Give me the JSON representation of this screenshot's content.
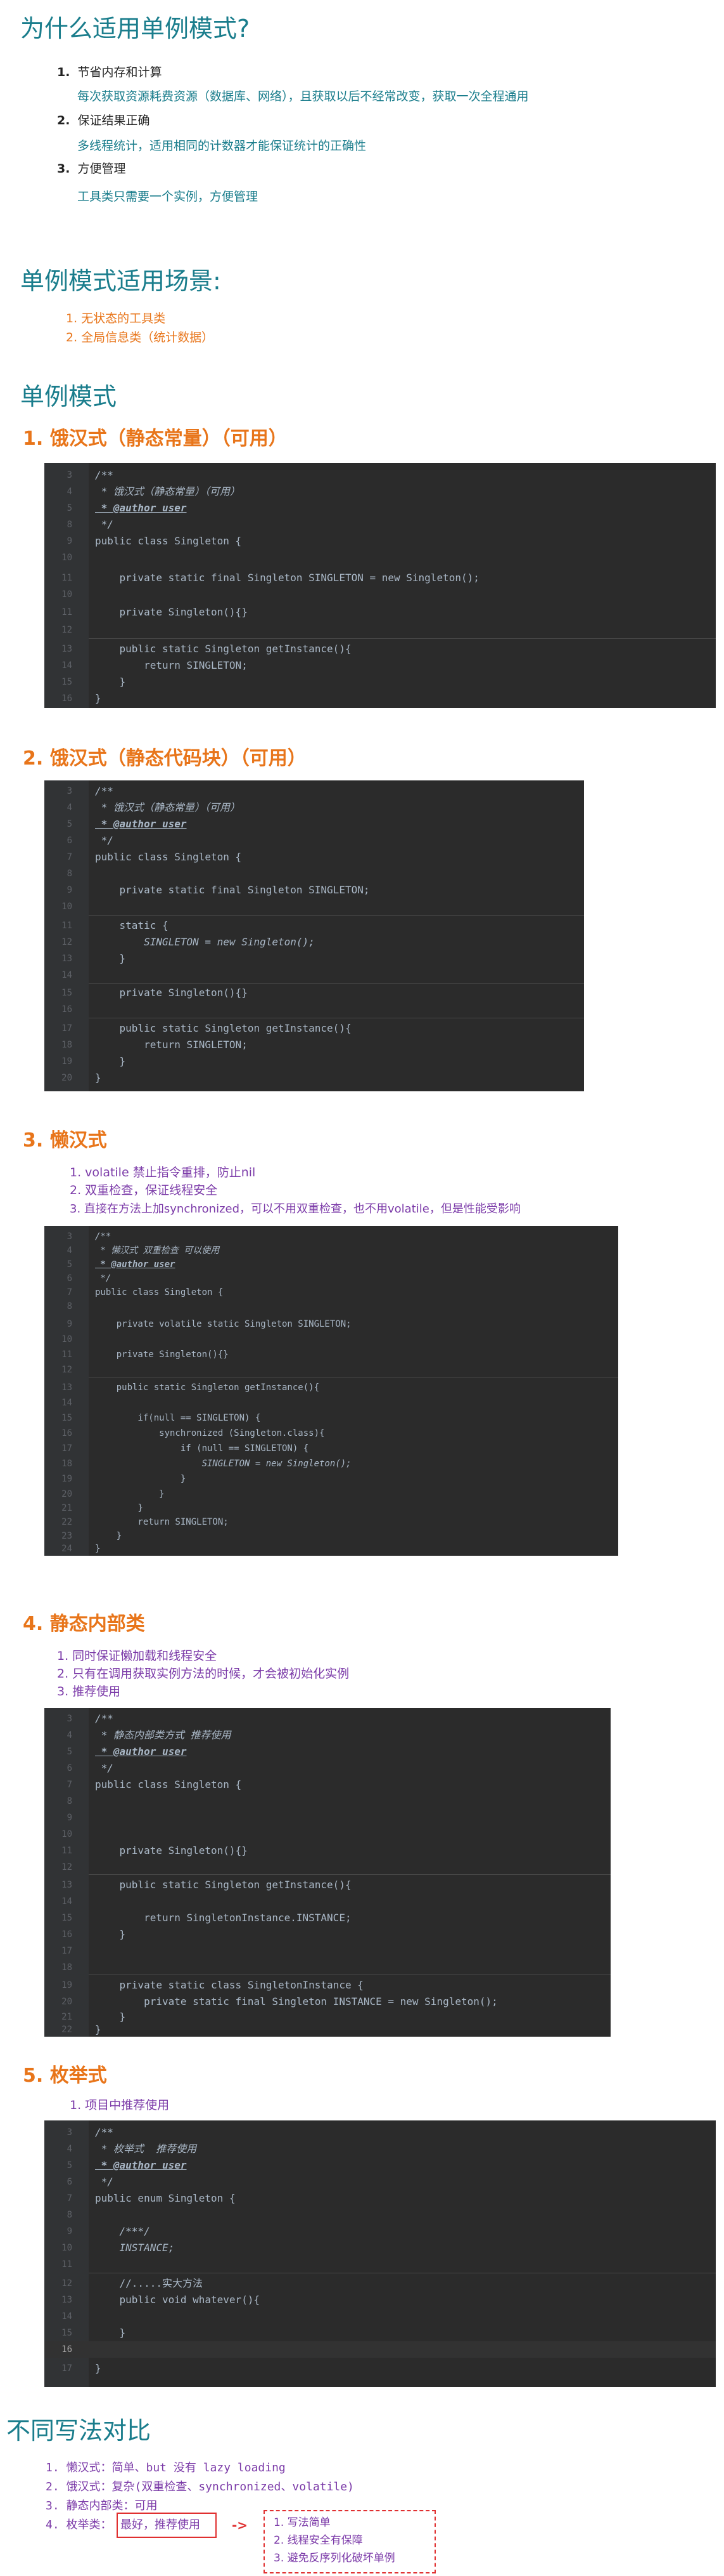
{
  "why": {
    "title": "为什么适用单例模式?",
    "items": [
      {
        "num": "1.",
        "label": "节省内存和计算",
        "desc": "每次获取资源耗费资源（数据库、网络），且获取以后不经常改变，获取一次全程通用"
      },
      {
        "num": "2.",
        "label": "保证结果正确",
        "desc": "多线程统计，适用相同的计数器才能保证统计的正确性"
      },
      {
        "num": "3.",
        "label": "方便管理",
        "desc": "工具类只需要一个实例，方便管理"
      }
    ]
  },
  "scenes": {
    "title": "单例模式适用场景:",
    "items": [
      "1.  无状态的工具类",
      "2.  全局信息类（统计数据）"
    ]
  },
  "singleton": {
    "title": "单例模式",
    "s1": {
      "title": "1. 饿汉式（静态常量）（可用）"
    },
    "s2": {
      "title": "2. 饿汉式（静态代码块）（可用）"
    },
    "s3": {
      "title": "3. 懒汉式",
      "items": [
        "1. volatile 禁止指令重排，防止nil",
        "2. 双重检查，保证线程安全",
        "3. 直接在方法上加synchronized，可以不用双重检查，也不用volatile，但是性能受影响"
      ]
    },
    "s4": {
      "title": "4. 静态内部类",
      "items": [
        "1. 同时保证懒加载和线程安全",
        "2. 只有在调用获取实例方法的时候，才会被初始化实例",
        "3. 推荐使用"
      ]
    },
    "s5": {
      "title": "5. 枚举式",
      "items": [
        "1. 项目中推荐使用"
      ]
    }
  },
  "compare": {
    "title": "不同写法对比",
    "items": [
      "1. 懒汉式：简单、but 没有 lazy loading",
      "2. 饿汉式：复杂(双重检查、synchronized、volatile)",
      "3. 静态内部类：可用",
      "4. 枚举类："
    ],
    "best": "最好，推荐使用",
    "arrow": "->",
    "reasons": [
      "1. 写法简单",
      "2. 线程安全有保障",
      "3. 避免反序列化破坏单例"
    ]
  },
  "code": {
    "c1": {
      "lines": [
        {
          "n": "3",
          "t": "/**"
        },
        {
          "n": "4",
          "t": " * 饿汉式（静态常量）（可用）"
        },
        {
          "n": "5",
          "t": " * @author user"
        },
        {
          "n": "8",
          "t": " */"
        },
        {
          "n": "9",
          "t": "public class Singleton {"
        },
        {
          "n": "10",
          "t": ""
        },
        {
          "n": "11",
          "t": "    private static final Singleton SINGLETON = new Singleton();"
        },
        {
          "n": "10",
          "t": ""
        },
        {
          "n": "11",
          "t": "    private Singleton(){}"
        },
        {
          "n": "12",
          "t": ""
        },
        {
          "n": "13",
          "t": "    public static Singleton getInstance(){"
        },
        {
          "n": "14",
          "t": "        return SINGLETON;"
        },
        {
          "n": "15",
          "t": "    }"
        },
        {
          "n": "16",
          "t": "}"
        }
      ]
    },
    "c2": {
      "lines": [
        {
          "n": "3",
          "t": "/**"
        },
        {
          "n": "4",
          "t": " * 饿汉式（静态常量）（可用）"
        },
        {
          "n": "5",
          "t": " * @author user"
        },
        {
          "n": "6",
          "t": " */"
        },
        {
          "n": "7",
          "t": "public class Singleton {"
        },
        {
          "n": "8",
          "t": ""
        },
        {
          "n": "9",
          "t": "    private static final Singleton SINGLETON;"
        },
        {
          "n": "10",
          "t": ""
        },
        {
          "n": "11",
          "t": "    static {"
        },
        {
          "n": "12",
          "t": "        SINGLETON = new Singleton();"
        },
        {
          "n": "13",
          "t": "    }"
        },
        {
          "n": "14",
          "t": ""
        },
        {
          "n": "15",
          "t": "    private Singleton(){}"
        },
        {
          "n": "16",
          "t": ""
        },
        {
          "n": "17",
          "t": "    public static Singleton getInstance(){"
        },
        {
          "n": "18",
          "t": "        return SINGLETON;"
        },
        {
          "n": "19",
          "t": "    }"
        },
        {
          "n": "20",
          "t": "}"
        }
      ]
    },
    "c3": {
      "lines": [
        {
          "n": "3",
          "t": "/**"
        },
        {
          "n": "4",
          "t": " * 懒汉式 双重检查 可以使用"
        },
        {
          "n": "5",
          "t": " * @author user"
        },
        {
          "n": "6",
          "t": " */"
        },
        {
          "n": "7",
          "t": "public class Singleton {"
        },
        {
          "n": "8",
          "t": ""
        },
        {
          "n": "9",
          "t": "    private volatile static Singleton SINGLETON;"
        },
        {
          "n": "10",
          "t": ""
        },
        {
          "n": "11",
          "t": "    private Singleton(){}"
        },
        {
          "n": "12",
          "t": ""
        },
        {
          "n": "13",
          "t": "    public static Singleton getInstance(){"
        },
        {
          "n": "14",
          "t": ""
        },
        {
          "n": "15",
          "t": "        if(null == SINGLETON) {"
        },
        {
          "n": "16",
          "t": "            synchronized (Singleton.class){"
        },
        {
          "n": "17",
          "t": "                if (null == SINGLETON) {"
        },
        {
          "n": "18",
          "t": "                    SINGLETON = new Singleton();"
        },
        {
          "n": "19",
          "t": "                }"
        },
        {
          "n": "20",
          "t": "            }"
        },
        {
          "n": "21",
          "t": "        }"
        },
        {
          "n": "22",
          "t": "        return SINGLETON;"
        },
        {
          "n": "23",
          "t": "    }"
        },
        {
          "n": "24",
          "t": "}"
        }
      ]
    },
    "c4": {
      "lines": [
        {
          "n": "3",
          "t": "/**"
        },
        {
          "n": "4",
          "t": " * 静态内部类方式 推荐使用"
        },
        {
          "n": "5",
          "t": " * @author user"
        },
        {
          "n": "6",
          "t": " */"
        },
        {
          "n": "7",
          "t": "public class Singleton {"
        },
        {
          "n": "8",
          "t": ""
        },
        {
          "n": "9",
          "t": ""
        },
        {
          "n": "10",
          "t": ""
        },
        {
          "n": "11",
          "t": "    private Singleton(){}"
        },
        {
          "n": "12",
          "t": ""
        },
        {
          "n": "13",
          "t": "    public static Singleton getInstance(){"
        },
        {
          "n": "14",
          "t": ""
        },
        {
          "n": "15",
          "t": "        return SingletonInstance.INSTANCE;"
        },
        {
          "n": "16",
          "t": "    }"
        },
        {
          "n": "17",
          "t": ""
        },
        {
          "n": "18",
          "t": ""
        },
        {
          "n": "19",
          "t": "    private static class SingletonInstance {"
        },
        {
          "n": "20",
          "t": "        private static final Singleton INSTANCE = new Singleton();"
        },
        {
          "n": "21",
          "t": "    }"
        },
        {
          "n": "22",
          "t": "}"
        }
      ]
    },
    "c5": {
      "lines": [
        {
          "n": "3",
          "t": "/**"
        },
        {
          "n": "4",
          "t": " * 枚举式  推荐使用"
        },
        {
          "n": "5",
          "t": " * @author user"
        },
        {
          "n": "6",
          "t": " */"
        },
        {
          "n": "7",
          "t": "public enum Singleton {"
        },
        {
          "n": "8",
          "t": ""
        },
        {
          "n": "9",
          "t": "    /***/"
        },
        {
          "n": "10",
          "t": "    INSTANCE;"
        },
        {
          "n": "11",
          "t": ""
        },
        {
          "n": "12",
          "t": "    //.....实大方法"
        },
        {
          "n": "13",
          "t": "    public void whatever(){"
        },
        {
          "n": "14",
          "t": ""
        },
        {
          "n": "15",
          "t": "    }"
        },
        {
          "n": "16",
          "t": ""
        },
        {
          "n": "17",
          "t": "}"
        }
      ]
    }
  }
}
